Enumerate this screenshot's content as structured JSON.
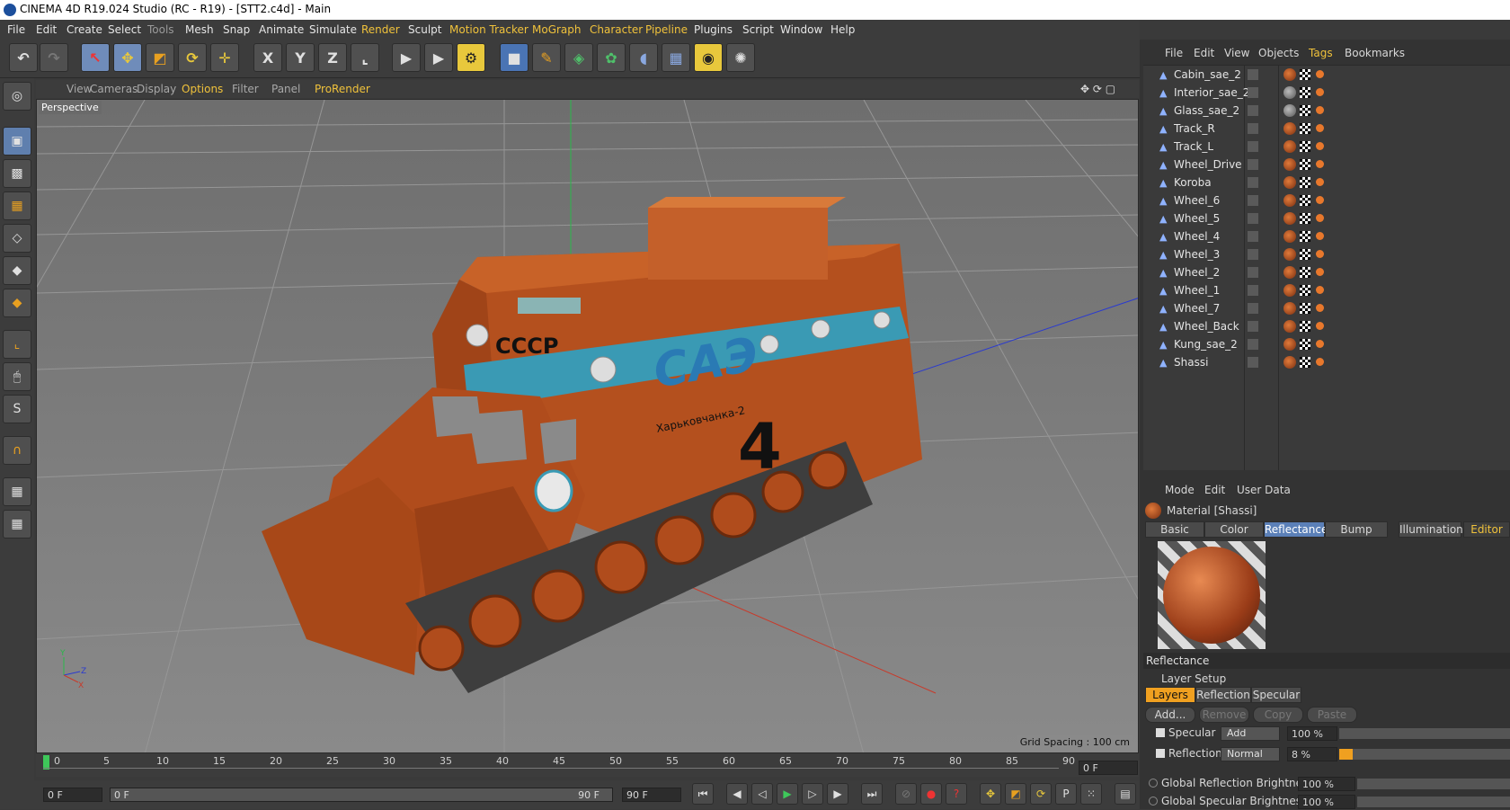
{
  "window": {
    "title": "CINEMA 4D R19.024 Studio (RC - R19) - [STT2.c4d] - Main"
  },
  "menubar": [
    "File",
    "Edit",
    "Create",
    "Select",
    "Tools",
    "Mesh",
    "Snap",
    "Animate",
    "Simulate",
    "Render",
    "Sculpt",
    "Motion Tracker",
    "MoGraph",
    "Character",
    "Pipeline",
    "Plugins",
    "Script",
    "Window",
    "Help"
  ],
  "toolbar_icons": [
    "undo-icon",
    "redo-icon",
    "selection-icon",
    "move-icon",
    "scale-icon",
    "rotate-icon",
    "transform-icon",
    "x-axis-icon",
    "y-axis-icon",
    "z-axis-icon",
    "coordinate-system-icon",
    "render-view-icon",
    "render-picture-viewer-icon",
    "render-settings-icon",
    "cube-icon",
    "pen-icon",
    "subdivision-icon",
    "cloner-icon",
    "deformer-icon",
    "floor-icon",
    "camera-icon",
    "light-icon"
  ],
  "viewport": {
    "menu": [
      "View",
      "Cameras",
      "Display",
      "Options",
      "Filter",
      "Panel",
      "ProRender"
    ],
    "active_menu": "Options",
    "label": "Perspective",
    "grid_spacing": "Grid Spacing : 100 cm",
    "vehicle_text": [
      "СССР",
      "САЭ",
      "Харьковчанка-2",
      "4"
    ],
    "axis_labels": [
      "Y",
      "Z",
      "X"
    ]
  },
  "timeline": {
    "ticks": [
      "0",
      "5",
      "10",
      "15",
      "20",
      "25",
      "30",
      "35",
      "40",
      "45",
      "50",
      "55",
      "60",
      "65",
      "70",
      "75",
      "80",
      "85",
      "90"
    ],
    "current_frame": "0 F"
  },
  "controls": {
    "start_frame": "0 F",
    "range_start": "0 F",
    "range_end": "90 F",
    "end_frame": "90 F"
  },
  "object_manager": {
    "menu": [
      "File",
      "Edit",
      "View",
      "Objects",
      "Tags",
      "Bookmarks"
    ],
    "objects": [
      "Cabin_sae_2",
      "Interior_sae_2",
      "Glass_sae_2",
      "Track_R",
      "Track_L",
      "Wheel_Drive",
      "Koroba",
      "Wheel_6",
      "Wheel_5",
      "Wheel_4",
      "Wheel_3",
      "Wheel_2",
      "Wheel_1",
      "Wheel_7",
      "Wheel_Back",
      "Kung_sae_2",
      "Shassi"
    ]
  },
  "attributes": {
    "menu": [
      "Mode",
      "Edit",
      "User Data"
    ],
    "title": "Material [Shassi]",
    "tabs": [
      "Basic",
      "Color",
      "Reflectance",
      "Bump",
      "Illumination",
      "Editor"
    ],
    "active_tab": "Reflectance",
    "section": "Reflectance",
    "layer_setup": "Layer Setup",
    "layer_tabs": [
      "Layers",
      "Reflection",
      "Specular"
    ],
    "layer_buttons": [
      "Add...",
      "Remove",
      "Copy",
      "Paste"
    ],
    "rows": [
      {
        "label": "Specular",
        "mode": "Add",
        "value": "100 %",
        "fill": 0
      },
      {
        "label": "Reflection",
        "mode": "Normal",
        "value": "8 %",
        "fill": 0.08
      }
    ],
    "globals": [
      {
        "label": "Global Reflection Brightness",
        "value": "100 %"
      },
      {
        "label": "Global Specular Brightness",
        "value": "100 %"
      }
    ]
  }
}
